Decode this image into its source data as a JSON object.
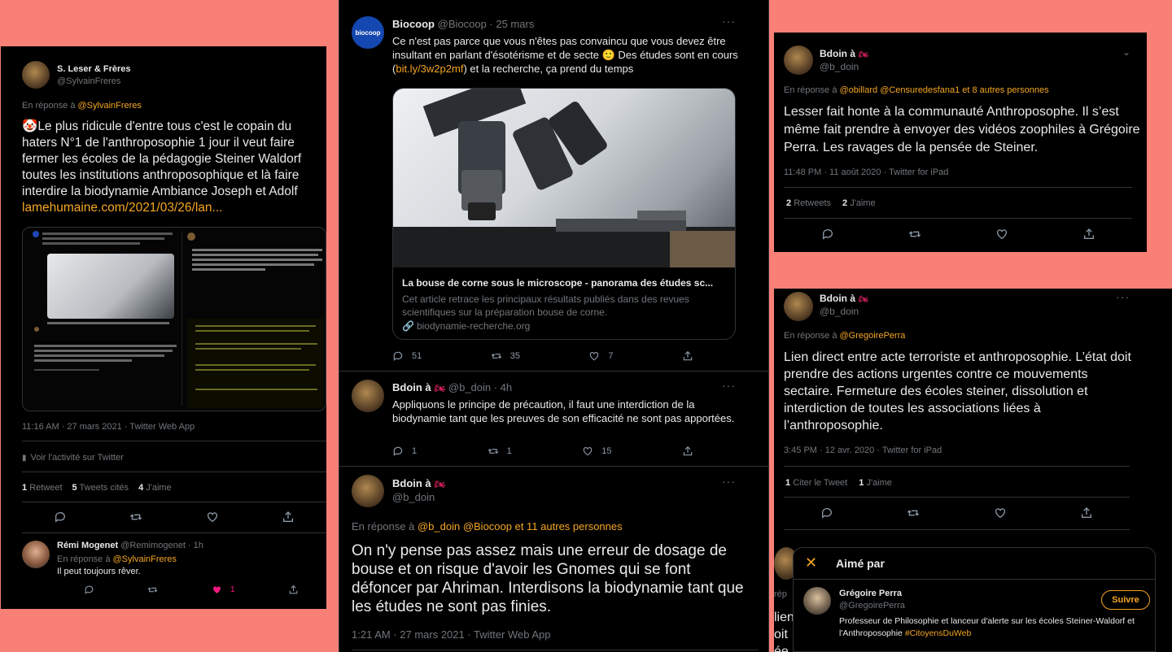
{
  "p1": {
    "author_name": "S. Leser & Frères",
    "author_handle": "@SylvainFreres",
    "reply_prefix": "En réponse à",
    "reply_to": "@SylvainFreres",
    "emoji": "🤡",
    "text": "Le plus ridicule d'entre tous c'est le copain du haters N°1 de l'anthroposophie 1 jour il veut faire fermer les écoles de la pédagogie Steiner Waldorf toutes les institutions anthroposophique et là faire interdire la biodynamie Ambiance Joseph et Adolf",
    "link": "lamehumaine.com/2021/03/26/lan...",
    "timestamp": "11:16 AM · 27 mars 2021 · Twitter Web App",
    "activity": "Voir l'activité sur Twitter",
    "retweets_count": "1",
    "retweets_label": "Retweet",
    "quotes_count": "5",
    "quotes_label": "Tweets cités",
    "likes_count": "4",
    "likes_label": "J'aime",
    "reply": {
      "name": "Rémi Mogenet",
      "handle": "@Remimogenet · 1h",
      "reply_prefix": "En réponse à",
      "reply_to": "@SylvainFreres",
      "text": "Il peut toujours rêver.",
      "likes": "1"
    }
  },
  "p2": {
    "avatar_text": "biocoop",
    "author_name": "Biocoop",
    "author_meta": "@Biocoop · 25 mars",
    "text_a": "Ce n'est pas parce que vous n'êtes pas convaincu que vous devez être insultant en parlant d'ésotérisme et de secte 🙂 Des études sont en cours (",
    "text_link": "bit.ly/3w2p2mf",
    "text_b": ") et la recherche, ça prend du temps",
    "card_title": "La bouse de corne sous le microscope - panorama des études sc...",
    "card_desc": "Cet article retrace les principaux résultats publiés dans des revues scientifiques sur la préparation bouse de corne.",
    "card_domain": "biodynamie-recherche.org",
    "replies": "51",
    "retweets": "35",
    "likes": "7",
    "t2": {
      "name": "Bdoin à",
      "meta": "@b_doin · 4h",
      "text": "Appliquons le principe de précaution, il faut une interdiction de la biodynamie tant que les preuves de son efficacité ne sont pas apportées.",
      "replies": "1",
      "retweets": "1",
      "likes": "15"
    },
    "t3": {
      "name": "Bdoin à",
      "handle": "@b_doin",
      "reply_prefix": "En réponse à",
      "reply_to": "@b_doin @Biocoop  et 11 autres personnes",
      "text": "On n'y pense pas assez mais une erreur de dosage de bouse et on risque d'avoir les Gnomes qui se font défoncer par Ahriman. Interdisons la biodynamie tant que les études ne sont pas finies.",
      "timestamp": "1:21 AM · 27 mars 2021 · Twitter Web App"
    }
  },
  "p3": {
    "name": "Bdoin à",
    "handle": "@b_doin",
    "reply_prefix": "En réponse à",
    "reply_to": "@obillard @Censuredesfana1  et 8 autres personnes",
    "text": "Lesser fait honte à la communauté Anthroposophe. Il s’est même fait prendre à envoyer des vidéos zoophiles à Grégoire Perra. Les ravages de la pensée de Steiner.",
    "timestamp": "11:48 PM · 11 août 2020 · Twitter for iPad",
    "retweets_count": "2",
    "retweets_label": "Retweets",
    "likes_count": "2",
    "likes_label": "J'aime"
  },
  "p4": {
    "name": "Bdoin à",
    "handle": "@b_doin",
    "reply_prefix": "En réponse à",
    "reply_to": "@GregoirePerra",
    "text": "Lien direct entre acte terroriste et anthroposophie. L’état doit prendre des actions urgentes contre ce mouvements sectaire. Fermeture des écoles steiner, dissolution et interdiction de toutes les associations liées à l’anthroposophie.",
    "timestamp": "3:45 PM · 12 avr. 2020 · Twitter for iPad",
    "quotes_count": "1",
    "quotes_label": "Citer le Tweet",
    "likes_count": "1",
    "likes_label": "J'aime",
    "behind_a": "lien",
    "behind_b": "oit",
    "behind_c": "ée",
    "behind_d": "rép"
  },
  "p5": {
    "title": "Aimé par",
    "name": "Grégoire Perra",
    "handle": "@GregoirePerra",
    "follow": "Suivre",
    "bio": "Professeur de Philosophie et lanceur d'alerte sur les écoles Steiner-Waldorf et l'Anthroposophie ",
    "hashtag": "#CitoyensDuWeb"
  }
}
